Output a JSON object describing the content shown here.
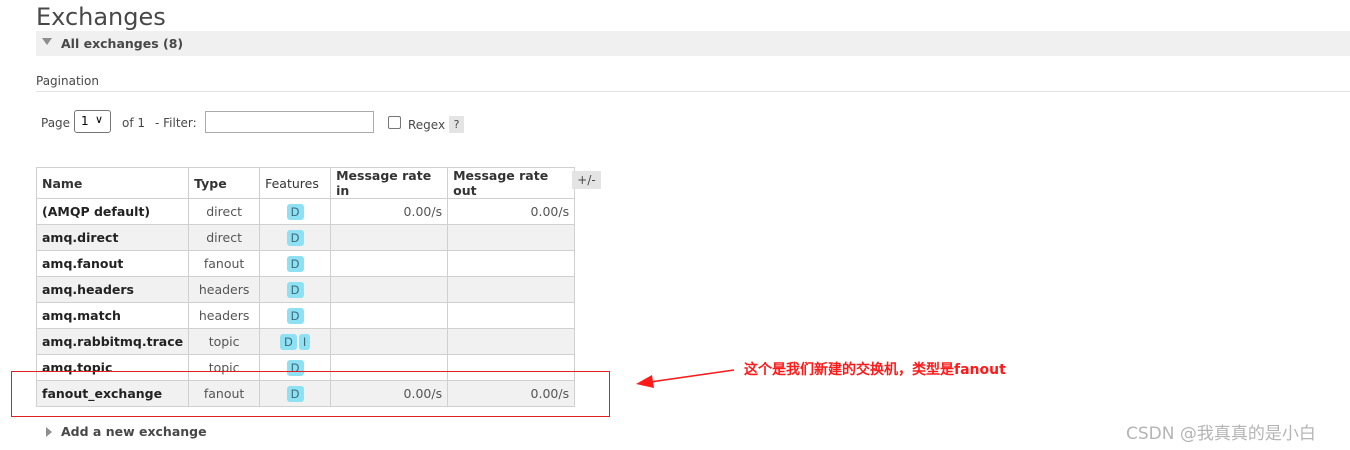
{
  "header": {
    "title": "Exchanges"
  },
  "section": {
    "label": "All exchanges (8)"
  },
  "pagination": {
    "title": "Pagination",
    "page_label": "Page",
    "page_value": "1",
    "of_label": "of 1",
    "filter_label": "- Filter:",
    "filter_value": "",
    "regex_label": "Regex",
    "help_label": "?"
  },
  "table": {
    "headers": [
      "Name",
      "Type",
      "Features",
      "Message rate in",
      "Message rate out"
    ],
    "columns_toggle": "+/-",
    "rows": [
      {
        "name": "(AMQP default)",
        "type": "direct",
        "features": [
          "D"
        ],
        "rate_in": "0.00/s",
        "rate_out": "0.00/s"
      },
      {
        "name": "amq.direct",
        "type": "direct",
        "features": [
          "D"
        ],
        "rate_in": "",
        "rate_out": ""
      },
      {
        "name": "amq.fanout",
        "type": "fanout",
        "features": [
          "D"
        ],
        "rate_in": "",
        "rate_out": ""
      },
      {
        "name": "amq.headers",
        "type": "headers",
        "features": [
          "D"
        ],
        "rate_in": "",
        "rate_out": ""
      },
      {
        "name": "amq.match",
        "type": "headers",
        "features": [
          "D"
        ],
        "rate_in": "",
        "rate_out": ""
      },
      {
        "name": "amq.rabbitmq.trace",
        "type": "topic",
        "features": [
          "D",
          "I"
        ],
        "rate_in": "",
        "rate_out": ""
      },
      {
        "name": "amq.topic",
        "type": "topic",
        "features": [
          "D"
        ],
        "rate_in": "",
        "rate_out": ""
      },
      {
        "name": "fanout_exchange",
        "type": "fanout",
        "features": [
          "D"
        ],
        "rate_in": "0.00/s",
        "rate_out": "0.00/s"
      }
    ]
  },
  "annotation": {
    "text": "这个是我们新建的交换机，类型是fanout",
    "color": "#ff1a1a"
  },
  "add_section": {
    "label": "Add a new exchange"
  },
  "watermark": {
    "text": "CSDN @我真真的是小白"
  },
  "colors": {
    "badge": "#8ee1f3",
    "row_alt": "#f1f1f1",
    "section_bar": "#f0f0f0"
  }
}
